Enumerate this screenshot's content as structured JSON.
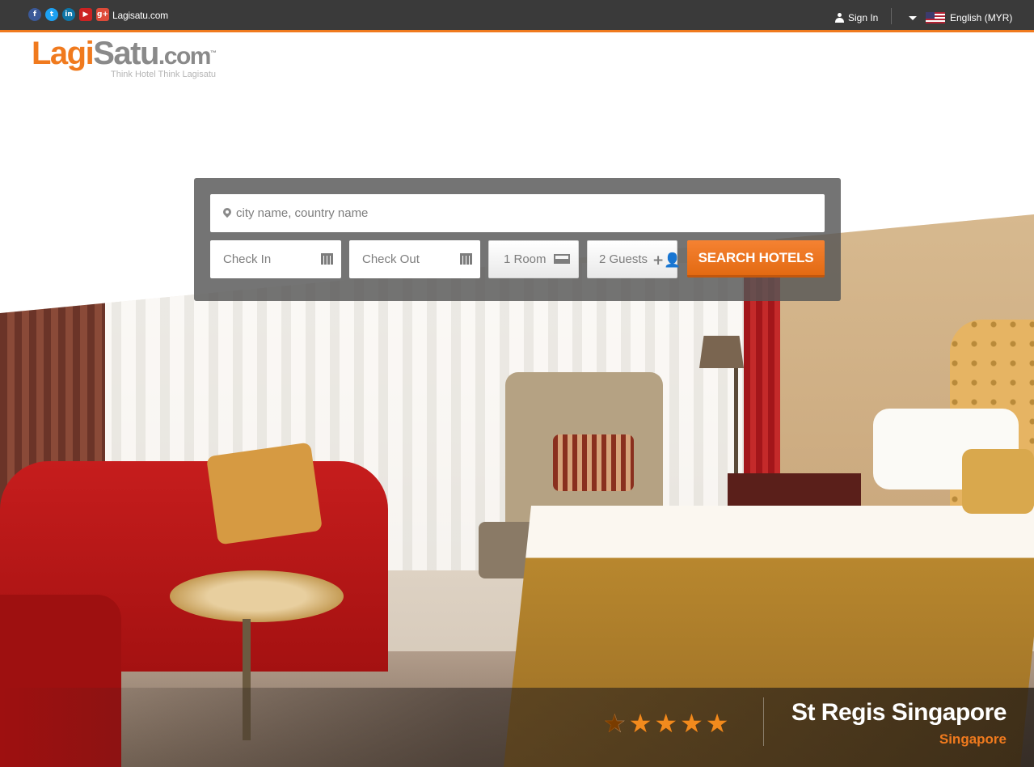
{
  "topbar": {
    "social_icons": [
      "facebook-icon",
      "twitter-icon",
      "linkedin-icon",
      "youtube-icon",
      "google-plus-icon"
    ],
    "site_link": "Lagisatu.com",
    "sign_in": "Sign In",
    "language": "English (MYR)"
  },
  "logo": {
    "part1": "Lagi",
    "part2": "Satu",
    "part3": ".com",
    "tm": "™",
    "tagline": "Think Hotel Think Lagisatu"
  },
  "search": {
    "destination_placeholder": "city name, country name",
    "checkin_placeholder": "Check In",
    "checkout_placeholder": "Check Out",
    "rooms": "1 Room",
    "guests": "2 Guests",
    "button": "SEARCH HOTELS"
  },
  "featured_hotel": {
    "name": "St Regis Singapore",
    "city": "Singapore",
    "rating": 4.5
  },
  "colors": {
    "accent": "#f07a1e",
    "topbar": "#3a3a3a"
  }
}
